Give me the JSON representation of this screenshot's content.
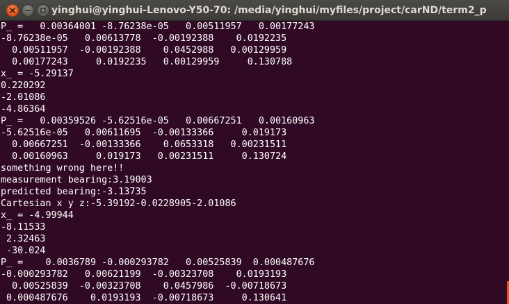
{
  "window": {
    "title": "yinghui@yinghui-Lenovo-Y50-70: /media/yinghui/myfiles/project/carND/term2_p",
    "accent_color": "#e95420",
    "background_color": "#300a24",
    "controls": [
      "close-icon",
      "minimize-icon",
      "maximize-icon"
    ]
  },
  "terminal": {
    "lines": [
      "P_ =   0.00364001 -8.76238e-05   0.00511957   0.00177243",
      "-8.76238e-05   0.00613778  -0.00192388    0.0192235",
      "  0.00511957  -0.00192388    0.0452988   0.00129959",
      "  0.00177243     0.0192235   0.00129959     0.130788",
      "x_ = -5.29137",
      "0.220292",
      "-2.01086",
      "-4.86364",
      "P_ =   0.00359526 -5.62516e-05   0.00667251   0.00160963",
      "-5.62516e-05   0.00611695  -0.00133366     0.019173",
      "  0.00667251  -0.00133366    0.0653318   0.00231511",
      "  0.00160963     0.019173   0.00231511     0.130724",
      "something wrong here!!",
      "measurement bearing:3.19003",
      "predicted bearing:-3.13735",
      "Cartesian x y z:-5.39192-0.0228905-2.01086",
      "x_ = -4.99944",
      "-8.11533",
      " 2.32463",
      " -30.024",
      "P_ =    0.0036789 -0.000293782   0.00525839  0.000487676",
      "-0.000293782   0.00621199  -0.00323708    0.0193193",
      "  0.00525839  -0.00323708    0.0457986  -0.00718673",
      " 0.000487676    0.0193193  -0.00718673     0.130641"
    ]
  }
}
